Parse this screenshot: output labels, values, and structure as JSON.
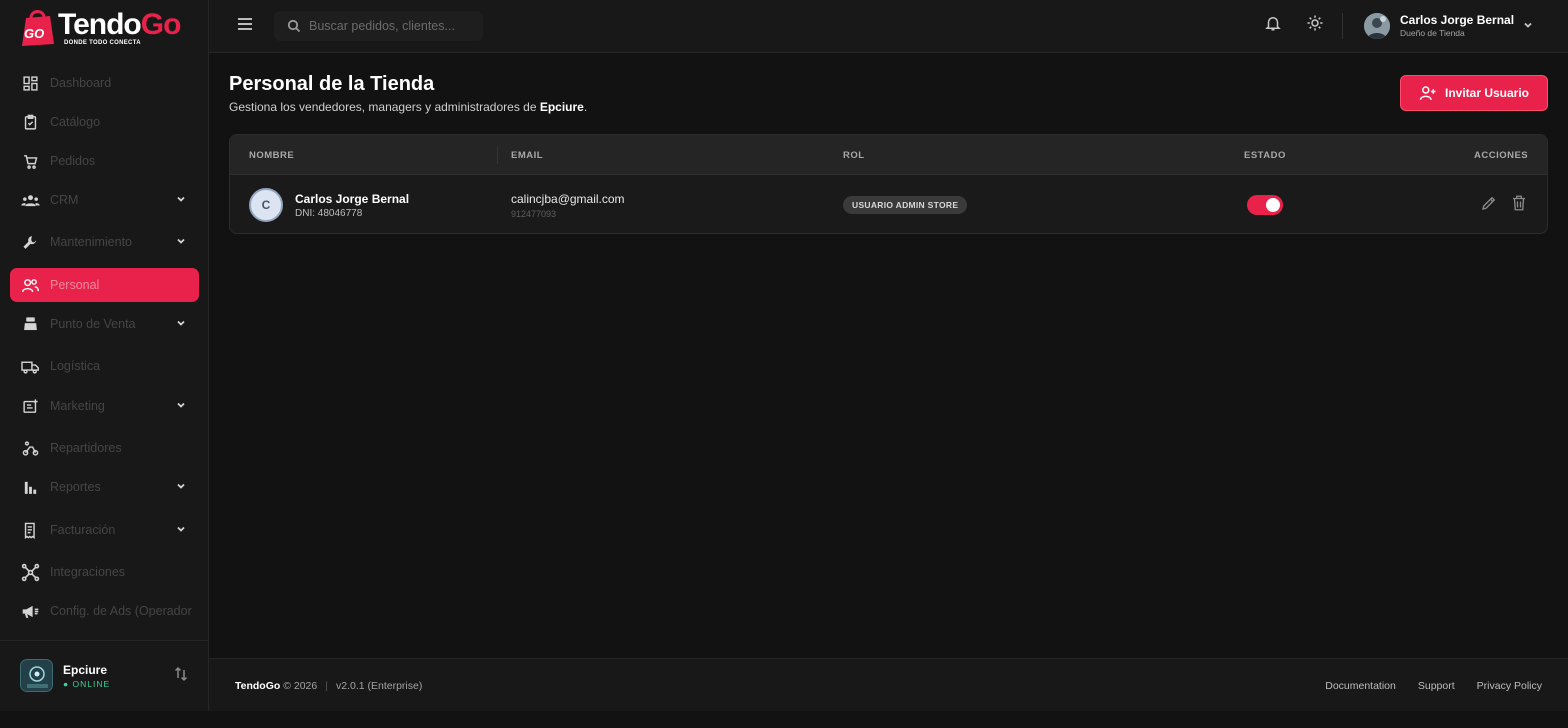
{
  "brand": {
    "name_part1": "Tendo",
    "name_part2": "Go",
    "badge": "GO",
    "tagline": "DONDE TODO CONECTA",
    "accent": "#e8224a"
  },
  "sidebar": {
    "items": [
      {
        "label": "Dashboard",
        "icon": "dashboard-icon"
      },
      {
        "label": "Catálogo",
        "icon": "catalog-clipboard-icon"
      },
      {
        "label": "Pedidos",
        "icon": "cart-icon"
      },
      {
        "label": "CRM",
        "icon": "users-group-icon",
        "expandable": true
      },
      {
        "label": "Mantenimiento",
        "icon": "wrench-icon",
        "expandable": true
      },
      {
        "label": "Personal",
        "icon": "people-icon",
        "active": true
      },
      {
        "label": "Punto de Venta",
        "icon": "cash-register-icon",
        "expandable": true
      },
      {
        "label": "Logística",
        "icon": "truck-icon"
      },
      {
        "label": "Marketing",
        "icon": "marketing-icon",
        "expandable": true
      },
      {
        "label": "Repartidores",
        "icon": "scooter-icon"
      },
      {
        "label": "Reportes",
        "icon": "bar-chart-icon",
        "expandable": true
      },
      {
        "label": "Facturación",
        "icon": "receipt-icon",
        "expandable": true
      },
      {
        "label": "Integraciones",
        "icon": "hub-icon"
      },
      {
        "label": "Config. de Ads (Operador)",
        "icon": "megaphone-icon"
      }
    ],
    "store": {
      "name": "Epciure",
      "status": "● ONLINE"
    }
  },
  "header": {
    "search_placeholder": "Buscar pedidos, clientes...",
    "user": {
      "name": "Carlos Jorge Bernal",
      "role": "Dueño de Tienda"
    }
  },
  "main": {
    "title": "Personal de la Tienda",
    "subtitle_prefix": "Gestiona los vendedores, managers y administradores de ",
    "subtitle_store": "Epciure",
    "subtitle_suffix": ".",
    "invite_label": "Invitar Usuario",
    "table": {
      "columns": [
        "NOMBRE",
        "EMAIL",
        "ROL",
        "ESTADO",
        "ACCIONES"
      ],
      "rows": [
        {
          "initial": "C",
          "name": "Carlos Jorge Bernal",
          "dni": "DNI: 48046778",
          "email": "calincjba@gmail.com",
          "phone": "912477093",
          "role": "USUARIO ADMIN STORE",
          "active": true
        }
      ]
    }
  },
  "footer": {
    "brand": "TendoGo",
    "copyright": "© 2026",
    "version": "v2.0.1 (Enterprise)",
    "links": [
      "Documentation",
      "Support",
      "Privacy Policy"
    ]
  }
}
